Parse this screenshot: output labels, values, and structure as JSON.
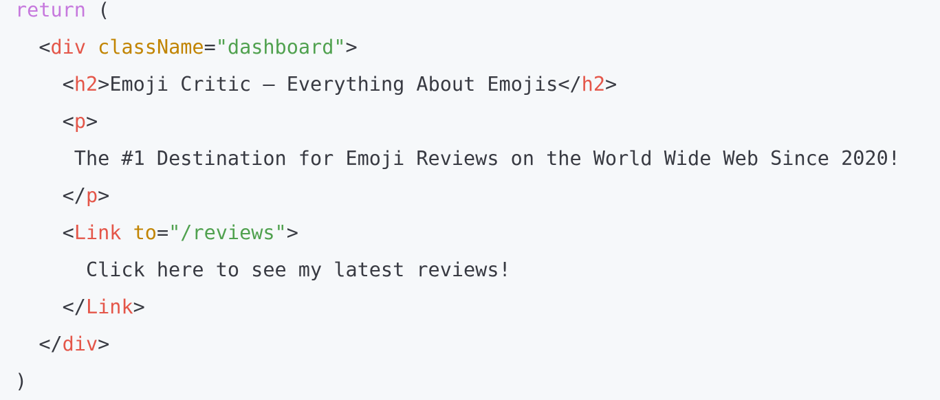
{
  "code": {
    "line1": {
      "keyword": "return",
      "paren": "("
    },
    "line2": {
      "tag": "div",
      "attr": "className",
      "value": "\"dashboard\""
    },
    "line3": {
      "tag_open": "h2",
      "text": "Emoji Critic — Everything About Emojis",
      "tag_close": "h2"
    },
    "line4": {
      "tag": "p"
    },
    "line5": {
      "text": "The #1 Destination for Emoji Reviews on the World Wide Web Since 2020!"
    },
    "line6": {
      "tag": "p"
    },
    "line7": {
      "tag": "Link",
      "attr": "to",
      "value": "\"/reviews\""
    },
    "line8": {
      "text": "Click here to see my latest reviews!"
    },
    "line9": {
      "tag": "Link"
    },
    "line10": {
      "tag": "div"
    },
    "line11": {
      "paren": ")"
    }
  },
  "colors": {
    "background": "#f6f8fa",
    "keyword": "#c678dd",
    "tag": "#e45649",
    "attribute": "#c18401",
    "string": "#50a14f",
    "text": "#383a42"
  }
}
